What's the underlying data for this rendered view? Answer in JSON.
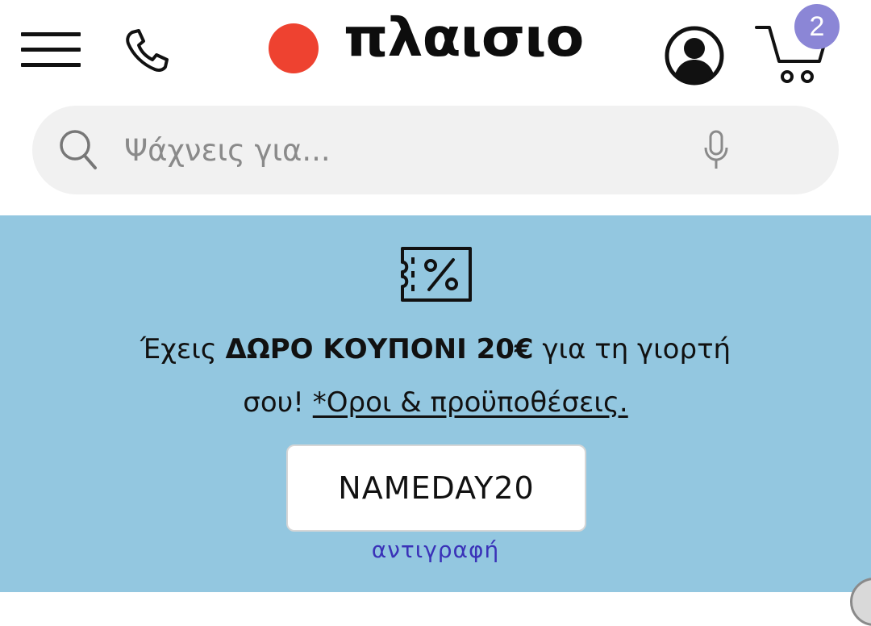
{
  "header": {
    "menu_icon": "hamburger-menu-icon",
    "phone_icon": "phone-icon",
    "logo_text": "πλαισιο",
    "brand_colors": {
      "dot": "#ee4230",
      "text": "#0d0d0d"
    },
    "account_icon": "user-account-icon",
    "cart_icon": "shopping-cart-icon",
    "cart_count": "2",
    "badge_color": "#8b86d6"
  },
  "search": {
    "placeholder": "Ψάχνεις για...",
    "value": "",
    "search_icon": "search-icon",
    "mic_icon": "microphone-icon"
  },
  "promo": {
    "background_color": "#93c7e0",
    "icon": "coupon-percent-icon",
    "line1_prefix": "Έχεις ",
    "line1_bold": "ΔΩΡΟ ΚΟΥΠΟΝΙ 20€",
    "line1_suffix": " για τη γιορτή",
    "line2_prefix": "σου! ",
    "terms_link": "*Οροι & προϋποθέσεις.",
    "coupon_code": "NAMEDAY20",
    "copy_label": "αντιγραφή",
    "copy_color": "#3a32b8"
  }
}
